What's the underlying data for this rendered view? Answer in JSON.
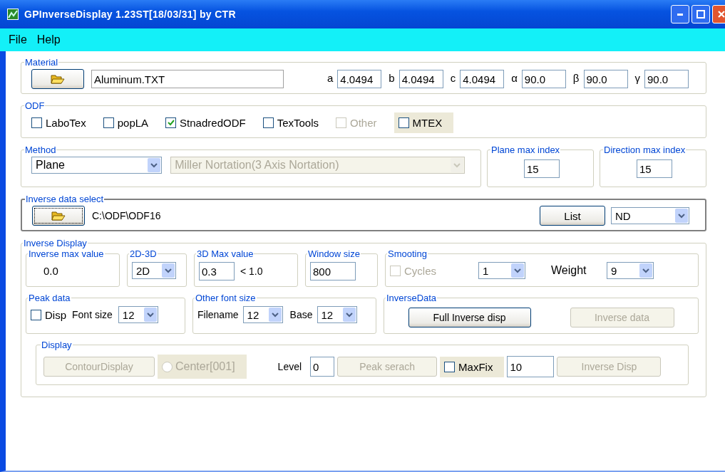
{
  "window": {
    "title": "GPInverseDisplay 1.23ST[18/03/31] by CTR"
  },
  "menu": [
    "File",
    "Help"
  ],
  "material": {
    "label": "Material",
    "file": "Aluminum.TXT",
    "params": [
      {
        "symbol": "a",
        "value": "4.0494"
      },
      {
        "symbol": "b",
        "value": "4.0494"
      },
      {
        "symbol": "c",
        "value": "4.0494"
      },
      {
        "symbol": "α",
        "value": "90.0"
      },
      {
        "symbol": "β",
        "value": "90.0"
      },
      {
        "symbol": "γ",
        "value": "90.0"
      }
    ]
  },
  "odf": {
    "label": "ODF",
    "options": [
      {
        "label": "LaboTex",
        "checked": false,
        "disabled": false,
        "shaded": false
      },
      {
        "label": "popLA",
        "checked": false,
        "disabled": false,
        "shaded": false
      },
      {
        "label": "StnadredODF",
        "checked": true,
        "disabled": false,
        "shaded": false
      },
      {
        "label": "TexTools",
        "checked": false,
        "disabled": false,
        "shaded": false
      },
      {
        "label": "Other",
        "checked": false,
        "disabled": true,
        "shaded": false
      },
      {
        "label": "MTEX",
        "checked": false,
        "disabled": false,
        "shaded": true
      }
    ]
  },
  "method": {
    "label": "Method",
    "type": "Plane",
    "notation": "Miller Nortation(3 Axis Nortation)",
    "notation_disabled": true
  },
  "plane_max_index": {
    "label": "Plane max index",
    "value": "15"
  },
  "direction_max_index": {
    "label": "Direction max index",
    "value": "15"
  },
  "inverse_data_select": {
    "label": "Inverse data select",
    "path": "C:\\ODF\\ODF16",
    "list_button": "List",
    "direction": "ND"
  },
  "inverse_display": {
    "label": "Inverse Display",
    "inverse_max": {
      "label": "Inverse max value",
      "value": "0.0"
    },
    "dimension": {
      "label": "2D-3D",
      "value": "2D"
    },
    "max_3d": {
      "label": "3D Max value",
      "value": "0.3",
      "limit": "< 1.0"
    },
    "window_size": {
      "label": "Window size",
      "value": "800"
    },
    "smoothing": {
      "label": "Smooting",
      "cycles": {
        "label": "Cycles",
        "checked": false,
        "disabled": true
      },
      "cycles_value": "1",
      "weight_label": "Weight",
      "weight_value": "9"
    },
    "peak_data": {
      "label": "Peak data",
      "disp": {
        "label": "Disp",
        "checked": false
      },
      "font_size_label": "Font size",
      "font_size": "12"
    },
    "other_font_size": {
      "label": "Other font size",
      "filename_label": "Filename",
      "filename": "12",
      "base_label": "Base",
      "base": "12"
    },
    "inverse_data": {
      "label": "InverseData",
      "buttons": [
        {
          "label": "Full Inverse disp",
          "disabled": false
        },
        {
          "label": "Inverse data",
          "disabled": true
        }
      ]
    },
    "display": {
      "label": "Display",
      "contour": {
        "label": "ContourDisplay",
        "disabled": true
      },
      "center": {
        "label": "Center[001]",
        "selected": false,
        "disabled": true
      },
      "level_label": "Level",
      "level": "0",
      "peak_search": {
        "label": "Peak serach",
        "disabled": true
      },
      "maxfix": {
        "label": "MaxFix",
        "checked": false
      },
      "maxfix_value": "10",
      "inverse_disp": {
        "label": "Inverse Disp",
        "disabled": true
      }
    }
  }
}
